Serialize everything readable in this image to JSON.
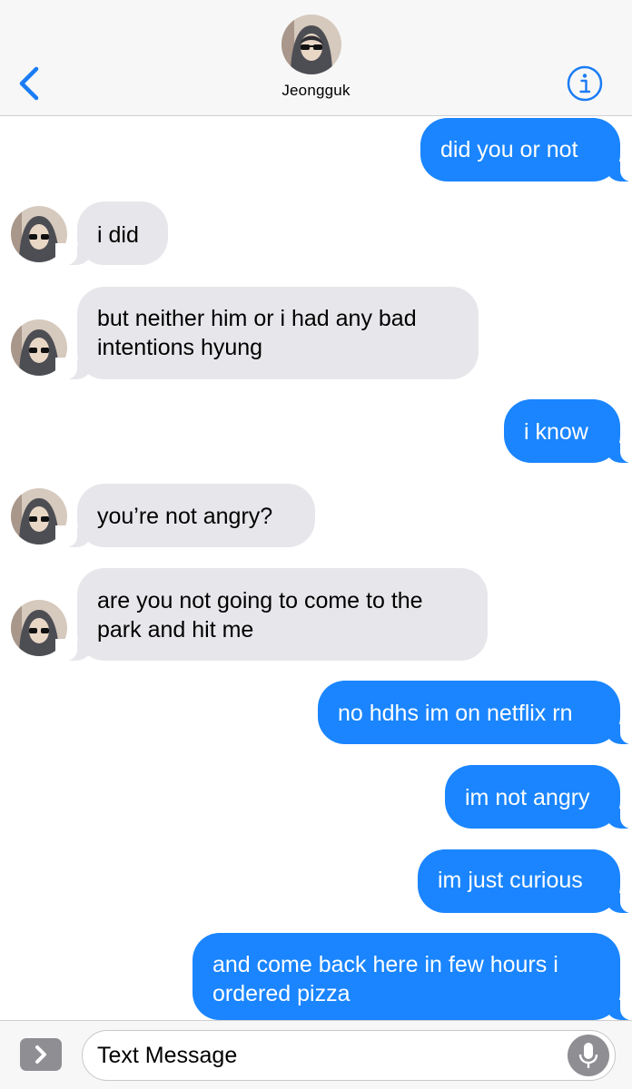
{
  "header": {
    "contact_name": "Jeongguk",
    "back_icon": "chevron-left-icon",
    "info_icon": "info-circle-icon"
  },
  "colors": {
    "sent_bubble": "#1a85ff",
    "received_bubble": "#e7e7eb",
    "accent": "#1a7cf5"
  },
  "messages": [
    {
      "direction": "sent",
      "lines": [
        "did you or not"
      ]
    },
    {
      "direction": "received",
      "lines": [
        "i did"
      ]
    },
    {
      "direction": "received",
      "lines": [
        "but neither him or i had any bad",
        "intentions hyung"
      ]
    },
    {
      "direction": "sent",
      "lines": [
        "i know"
      ]
    },
    {
      "direction": "received",
      "lines": [
        "you’re not angry?"
      ]
    },
    {
      "direction": "received",
      "lines": [
        "are you not going to come to the",
        "park and hit me"
      ]
    },
    {
      "direction": "sent",
      "lines": [
        "no hdhs im on netflix rn"
      ]
    },
    {
      "direction": "sent",
      "lines": [
        "im not angry"
      ]
    },
    {
      "direction": "sent",
      "lines": [
        "im just curious"
      ]
    },
    {
      "direction": "sent",
      "lines": [
        "and come back here in few hours i",
        "ordered pizza"
      ]
    }
  ],
  "composer": {
    "placeholder": "Text Message",
    "apps_icon": "chevron-right-icon",
    "mic_icon": "microphone-icon"
  }
}
